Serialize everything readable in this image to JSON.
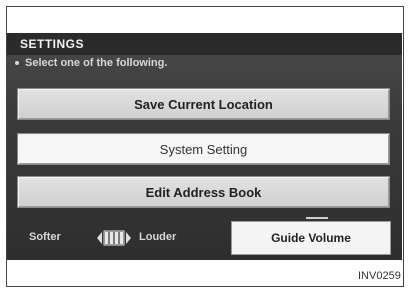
{
  "header": {
    "title": "SETTINGS",
    "subtitle": "Select one of the following."
  },
  "menu": {
    "items": [
      {
        "label": "Save Current Location"
      },
      {
        "label": "System Setting"
      },
      {
        "label": "Edit Address Book"
      }
    ]
  },
  "volume": {
    "softer_label": "Softer",
    "louder_label": "Louder",
    "level_fraction": 0.5,
    "guide_label": "Guide Volume"
  },
  "figure": {
    "code": "INV0259"
  },
  "colors": {
    "screen_bg": "#3a3a3a",
    "title_bar": "#2b2b2b",
    "button_face": "#d8d8d8",
    "selected_button": "#f6f6f6"
  }
}
